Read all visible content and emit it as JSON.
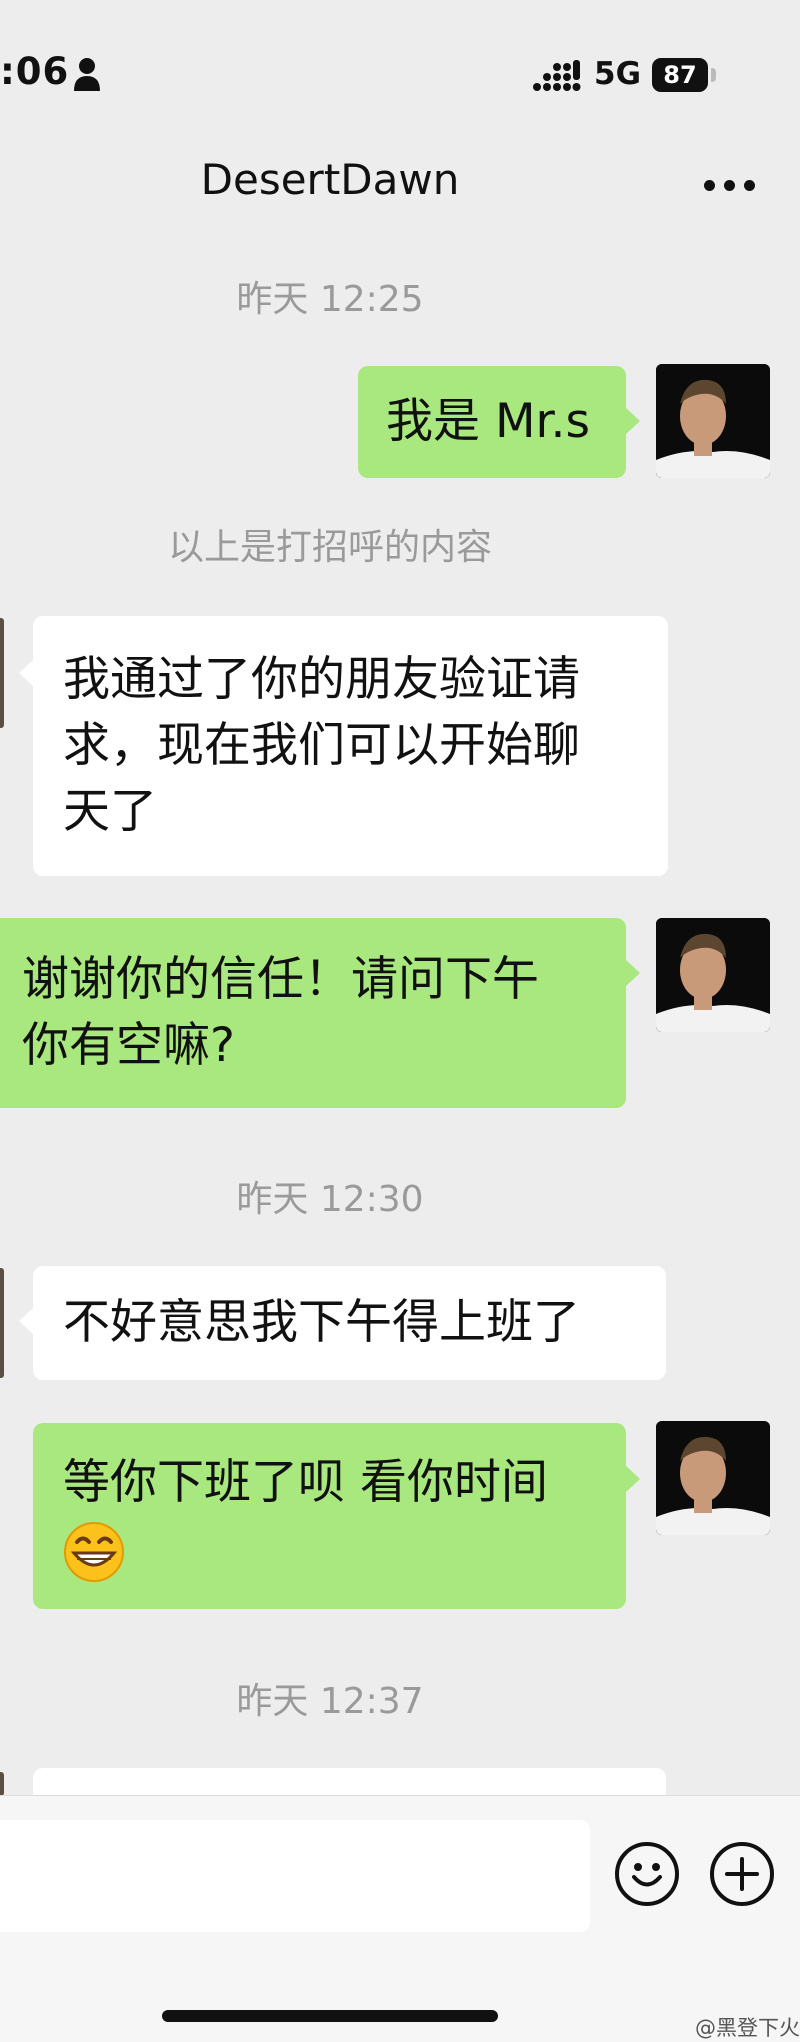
{
  "status_bar": {
    "time": ":06",
    "network": "5G",
    "battery": "87"
  },
  "header": {
    "title": "DesertDawn"
  },
  "timestamps": [
    "昨天 12:25",
    "昨天 12:30",
    "昨天 12:37"
  ],
  "system_note": "以上是打招呼的内容",
  "messages": [
    {
      "from": "me",
      "lines": [
        "我是 Mr.s"
      ]
    },
    {
      "from": "them",
      "lines": [
        "我通过了你的朋友验证请",
        "求，现在我们可以开始聊",
        "天了"
      ]
    },
    {
      "from": "me",
      "lines": [
        "谢谢你的信任！请问下午",
        "你有空嘛?"
      ]
    },
    {
      "from": "them",
      "lines": [
        "不好意思我下午得上班了"
      ]
    },
    {
      "from": "me",
      "lines": [
        "等你下班了呗 看你时间"
      ]
    }
  ],
  "input": {
    "value": "",
    "placeholder": ""
  },
  "icons": {
    "more": "more-dots-icon",
    "emoji": "emoji-face-icon",
    "plus": "plus-circle-icon",
    "grin": "grinning-emoji"
  },
  "watermark": "@黑登下火",
  "colors": {
    "background": "#ededed",
    "my_bubble": "#a9e87e",
    "their_bubble": "#ffffff",
    "timestamp": "#9a9a9a"
  }
}
